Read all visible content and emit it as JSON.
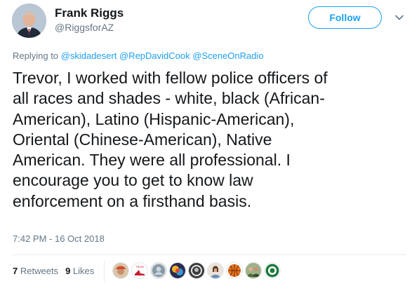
{
  "author": {
    "name": "Frank Riggs",
    "handle": "@RiggsforAZ"
  },
  "follow_label": "Follow",
  "reply": {
    "prefix": "Replying to",
    "mentions": [
      "@skidadesert",
      "@RepDavidCook",
      "@SceneOnRadio"
    ]
  },
  "tweet_text": "Trevor, I worked with fellow police officers of\nall races and shades - white, black (African-\nAmerican), Latino (Hispanic-American),\nOriental (Chinese-American), Native\nAmerican. They were all professional. I\nencourage you to get to know law\nenforcement on a firsthand basis.",
  "timestamp": "7:42 PM - 16 Oct 2018",
  "stats": {
    "retweets_count": "7",
    "retweets_label": "Retweets",
    "likes_count": "9",
    "likes_label": "Likes"
  },
  "liker_avatars": [
    "person-cap-avatar",
    "shoe-logo-avatar",
    "default-gray-avatar",
    "colorful-graphic-avatar",
    "dark-portrait-avatar",
    "woman-portrait-avatar",
    "basketball-avatar",
    "group-photo-avatar",
    "green-logo-avatar"
  ],
  "colors": {
    "accent": "#1da1f2",
    "secondary_text": "#657786",
    "primary_text": "#14171a",
    "divider": "#e6ecf0"
  }
}
